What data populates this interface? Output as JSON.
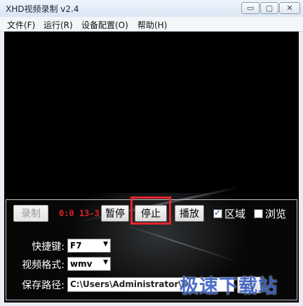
{
  "window": {
    "title": "XHD视频录制 v2.4"
  },
  "window_buttons": {
    "minimize": "▭",
    "maximize": "▢",
    "close": "✕"
  },
  "menu": [
    "文件(F)",
    "运行(R)",
    "设备配置(O)",
    "帮助(H)"
  ],
  "controls": {
    "record_label": "录制",
    "timer": "0:0 13-3",
    "pause_label": "暂停",
    "stop_label": "停止",
    "play_label": "播放",
    "region_label": "区域",
    "region_checked": true,
    "browse_label": "浏览",
    "browse_checked": false
  },
  "settings": {
    "hotkey_label": "快捷键:",
    "hotkey_value": "F7",
    "format_label": "视频格式:",
    "format_value": "wmv",
    "path_label": "保存路径:",
    "path_value": "C:\\Users\\Administrator\\D",
    "select_label": "选"
  },
  "watermark": "极速下载站",
  "colors": {
    "stop_highlight": "#e8262d",
    "timer": "#e02020"
  }
}
